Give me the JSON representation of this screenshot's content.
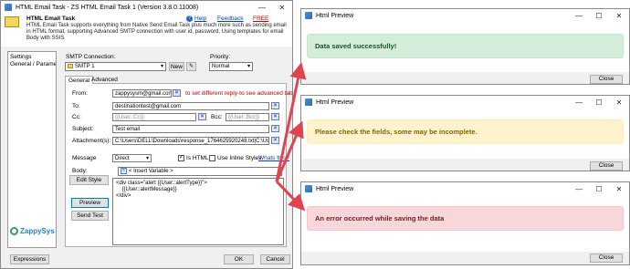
{
  "main": {
    "title": "HTML Email Task - ZS HTML Email Task 1 (Version 3.8.0.11008)",
    "header_title": "HTML Email Task",
    "header_desc": "HTML Email Task supports everything from Native Send Email Task plus much more such as sending email in HTML format, supporting Advanced SMTP connection with user id, password, Using templates for email Body with SSIS",
    "help": "Help",
    "feedback": "Feedback",
    "free": "FREE",
    "nav": [
      "Settings",
      "General / Parameters"
    ],
    "smtp_label": "SMTP Connection:",
    "smtp_value": "SMTP 1",
    "new_button": "New",
    "priority_label": "Priority:",
    "priority_value": "Normal",
    "tabs": [
      "General",
      "Advanced"
    ],
    "from_label": "From:",
    "from_value": "zappysysm@gmail.con",
    "from_hint": "to set different reply-to see advanced tab",
    "to_label": "To:",
    "to_value": "destinationtest@gmail.com",
    "cc_label": "Cc:",
    "cc_placeholder": "{{User::Cc}}",
    "bcc_label": "Bcc:",
    "bcc_placeholder": "{{User::Bcc}}",
    "subject_label": "Subject:",
    "subject_value": "Test email",
    "attach_label": "Attachment(s):",
    "attach_value": "C:\\Users\\DELL\\Downloads\\response_1764625920248.txt|C:\\Users\\D",
    "message_label": "Message",
    "message_type": "Direct",
    "is_html": "Is HTML",
    "inline_styles": "Use Inline Styles",
    "whats_this": "Whats this?",
    "body_label": "Body:",
    "insert_variable": "< Insert Variable >",
    "edit_style": "Edit Style",
    "preview": "Preview",
    "send_test": "Send Test",
    "body_lines": [
      "<div class=\"alert {{User::alertType}}\">",
      "    {{User::alertMessage}}",
      "</div>"
    ],
    "logo": "ZappySys",
    "expressions": "Expressions",
    "ok": "OK",
    "cancel": "Cancel",
    "help_button": "Help"
  },
  "previews": [
    {
      "title": "Html Preview",
      "message": "Data saved successfully!",
      "close": "Close"
    },
    {
      "title": "Html Preview",
      "message": "Please check the fields, some may be incomplete.",
      "close": "Close"
    },
    {
      "title": "Html Preview",
      "message": "An error occurred while saving the data",
      "close": "Close"
    }
  ],
  "colors": {
    "success_bg": "#d4edda",
    "success_fg": "#155724",
    "warning_bg": "#fff3cd",
    "warning_fg": "#856404",
    "danger_bg": "#f8d7da",
    "danger_fg": "#721c24",
    "arrow": "#e0454f"
  }
}
